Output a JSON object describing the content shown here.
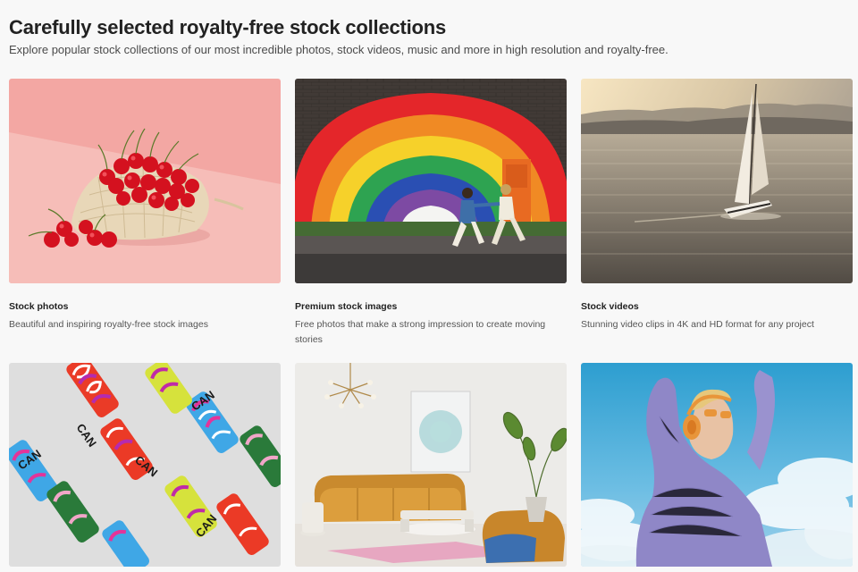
{
  "header": {
    "title": "Carefully selected royalty-free stock collections",
    "subtitle": "Explore popular stock collections of our most incredible photos, stock videos, music and more in high resolution and royalty-free."
  },
  "collections": [
    {
      "title": "Stock photos",
      "description": "Beautiful and inspiring royalty-free stock images",
      "image": "cherries-in-net-bag-image"
    },
    {
      "title": "Premium stock images",
      "description": "Free photos that make a strong impression to create moving stories",
      "image": "rainbow-wall-couple-image"
    },
    {
      "title": "Stock videos",
      "description": "Stunning video clips in 4K and HD format for any project",
      "image": "sailboat-lake-image"
    },
    {
      "title": "",
      "description": "",
      "image": "colorful-cans-image"
    },
    {
      "title": "",
      "description": "",
      "image": "living-room-interior-image"
    },
    {
      "title": "",
      "description": "",
      "image": "woman-sky-headphones-image"
    }
  ],
  "can_label": "CAN",
  "colors": {
    "background": "#f8f8f8",
    "title": "#222222",
    "text": "#555555"
  }
}
